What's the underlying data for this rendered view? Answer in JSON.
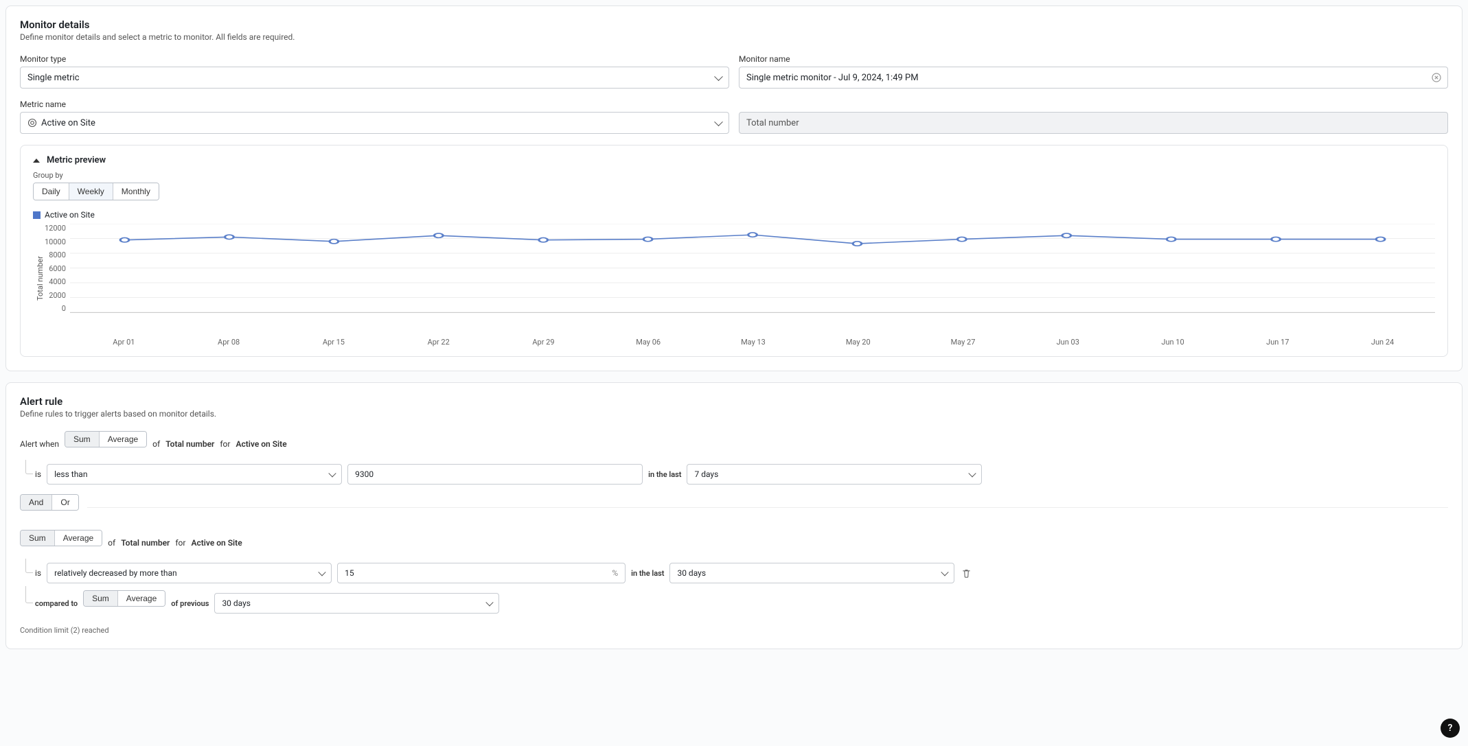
{
  "monitor_details": {
    "title": "Monitor details",
    "subtitle": "Define monitor details and select a metric to monitor. All fields are required.",
    "monitor_type": {
      "label": "Monitor type",
      "value": "Single metric"
    },
    "monitor_name": {
      "label": "Monitor name",
      "value": "Single metric monitor - Jul 9, 2024, 1:49 PM"
    },
    "metric_name": {
      "label": "Metric name",
      "value": "Active on Site"
    },
    "metric_agg_readonly": "Total number"
  },
  "preview": {
    "title": "Metric preview",
    "group_by_label": "Group by",
    "group_by_options": [
      "Daily",
      "Weekly",
      "Monthly"
    ],
    "group_by_selected": "Weekly",
    "legend": "Active on Site",
    "y_axis_title": "Total number",
    "y_ticks": [
      "12000",
      "10000",
      "8000",
      "6000",
      "4000",
      "2000",
      "0"
    ]
  },
  "chart_data": {
    "type": "line",
    "title": "",
    "xlabel": "",
    "ylabel": "Total number",
    "ylim": [
      0,
      12000
    ],
    "categories": [
      "Apr 01",
      "Apr 08",
      "Apr 15",
      "Apr 22",
      "Apr 29",
      "May 06",
      "May 13",
      "May 20",
      "May 27",
      "Jun 03",
      "Jun 10",
      "Jun 17",
      "Jun 24"
    ],
    "series": [
      {
        "name": "Active on Site",
        "values": [
          9800,
          10200,
          9600,
          10400,
          9800,
          9900,
          10500,
          9300,
          9900,
          10400,
          9900,
          9900,
          9900
        ]
      }
    ]
  },
  "alert_rule": {
    "title": "Alert rule",
    "subtitle": "Define rules to trigger alerts based on monitor details.",
    "alert_when_label": "Alert when",
    "agg_options": [
      "Sum",
      "Average"
    ],
    "of_label": "of",
    "for_label": "for",
    "measure": "Total number",
    "metric": "Active on Site",
    "cond1": {
      "agg_selected": "Sum",
      "is_label": "is",
      "comparator": "less than",
      "value": "9300",
      "in_last_label": "in the last",
      "period": "7 days"
    },
    "joiner": {
      "options": [
        "And",
        "Or"
      ],
      "selected": "And"
    },
    "cond2": {
      "agg_selected": "Sum",
      "is_label": "is",
      "comparator": "relatively decreased by more than",
      "value": "15",
      "value_unit": "%",
      "in_last_label": "in the last",
      "period": "30 days",
      "compared_to_label": "compared to",
      "compared_agg_options": [
        "Sum",
        "Average"
      ],
      "compared_agg_selected": "Sum",
      "of_previous_label": "of previous",
      "prev_period": "30 days"
    },
    "limit_msg": "Condition limit (2) reached"
  },
  "misc": {
    "help": "?"
  }
}
